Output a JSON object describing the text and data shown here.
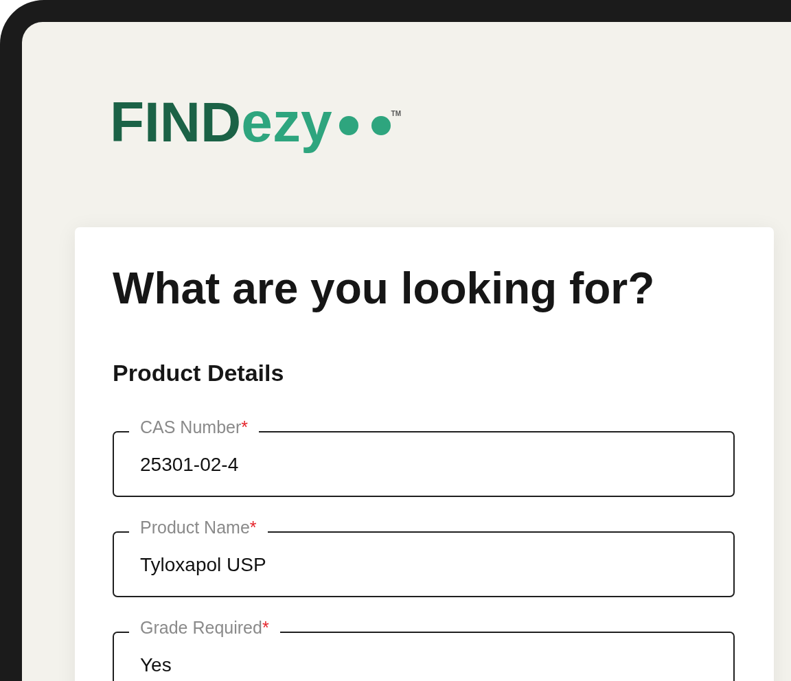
{
  "logo": {
    "dark_part": "FIND",
    "light_part": "ezy",
    "trademark": "TM"
  },
  "card": {
    "title": "What are you looking for?",
    "section": "Product Details",
    "fields": [
      {
        "label": "CAS Number",
        "required_mark": "*",
        "value": "25301-02-4"
      },
      {
        "label": "Product Name",
        "required_mark": "*",
        "value": "Tyloxapol USP"
      },
      {
        "label": "Grade Required",
        "required_mark": "*",
        "value": "Yes"
      }
    ]
  }
}
